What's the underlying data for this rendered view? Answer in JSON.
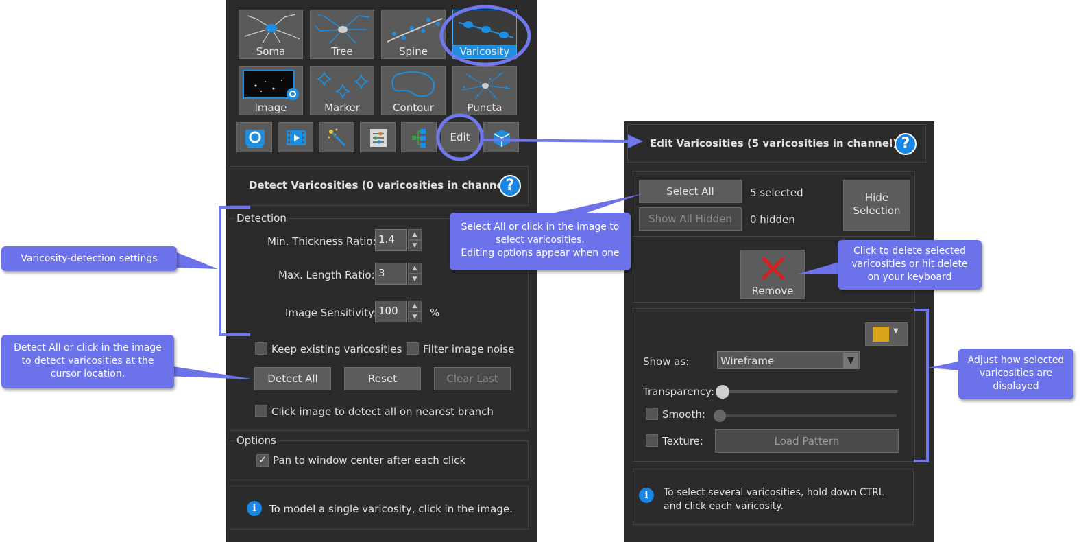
{
  "left_panel": {
    "tiles": [
      {
        "label": "Soma"
      },
      {
        "label": "Tree"
      },
      {
        "label": "Spine"
      },
      {
        "label": "Varicosity"
      },
      {
        "label": "Image"
      },
      {
        "label": "Marker"
      },
      {
        "label": "Contour"
      },
      {
        "label": "Puncta"
      }
    ],
    "edit_label": "Edit",
    "detect_title": "Detect Varicosities (0 varicosities in channel)",
    "help_symbol": "?",
    "detection": {
      "section_label": "Detection",
      "min_thickness_label": "Min. Thickness Ratio:",
      "min_thickness_value": "1.4",
      "max_length_label": "Max. Length Ratio:",
      "max_length_value": "3",
      "sensitivity_label": "Image Sensitivity:",
      "sensitivity_value": "100",
      "sensitivity_unit": "%",
      "keep_existing_label": "Keep existing varicosities",
      "filter_noise_label": "Filter image noise",
      "detect_all_label": "Detect All",
      "reset_label": "Reset",
      "clear_last_label": "Clear Last",
      "nearest_branch_label": "Click image to detect all on nearest branch"
    },
    "options": {
      "section_label": "Options",
      "pan_label": "Pan to window center after each click"
    },
    "info_symbol": "i",
    "info_text": "To model a single varicosity, click in the image."
  },
  "right_panel": {
    "title": "Edit Varicosities (5 varicosities in channel)",
    "help_symbol": "?",
    "select_all_label": "Select All",
    "selected_count": "5 selected",
    "show_all_hidden_label": "Show All Hidden",
    "hidden_count": "0 hidden",
    "hide_selection_line1": "Hide",
    "hide_selection_line2": "Selection",
    "remove_label": "Remove",
    "swatch_color": "#d8a316",
    "show_as_label": "Show as:",
    "show_as_value": "Wireframe",
    "transparency_label": "Transparency:",
    "transparency_value": 0.0,
    "smooth_label": "Smooth:",
    "smooth_value": 0.0,
    "texture_label": "Texture:",
    "load_pattern_label": "Load Pattern",
    "info_symbol": "i",
    "info_text_line1": "To select several varicosities, hold down CTRL",
    "info_text_line2": "and click each varicosity."
  },
  "callouts": {
    "detection_settings": "Varicosity-detection settings",
    "detect_all_line1": "Detect All or click in the image",
    "detect_all_line2": "to detect varicosities at the",
    "detect_all_line3": "cursor location.",
    "select_all_line1": "Select All or click in the image to",
    "select_all_line2": "select varicosities.",
    "select_all_line3": "Editing options appear when one",
    "delete_line1": "Click to delete selected",
    "delete_line2": "varicosities or hit delete",
    "delete_line3": "on your keyboard",
    "adjust_line1": "Adjust how selected",
    "adjust_line2": "varicosities are",
    "adjust_line3": "displayed"
  },
  "colors": {
    "callout": "#6b72ea",
    "accent_blue": "#1e8fe0",
    "panel_bg": "#2b2b2b"
  }
}
